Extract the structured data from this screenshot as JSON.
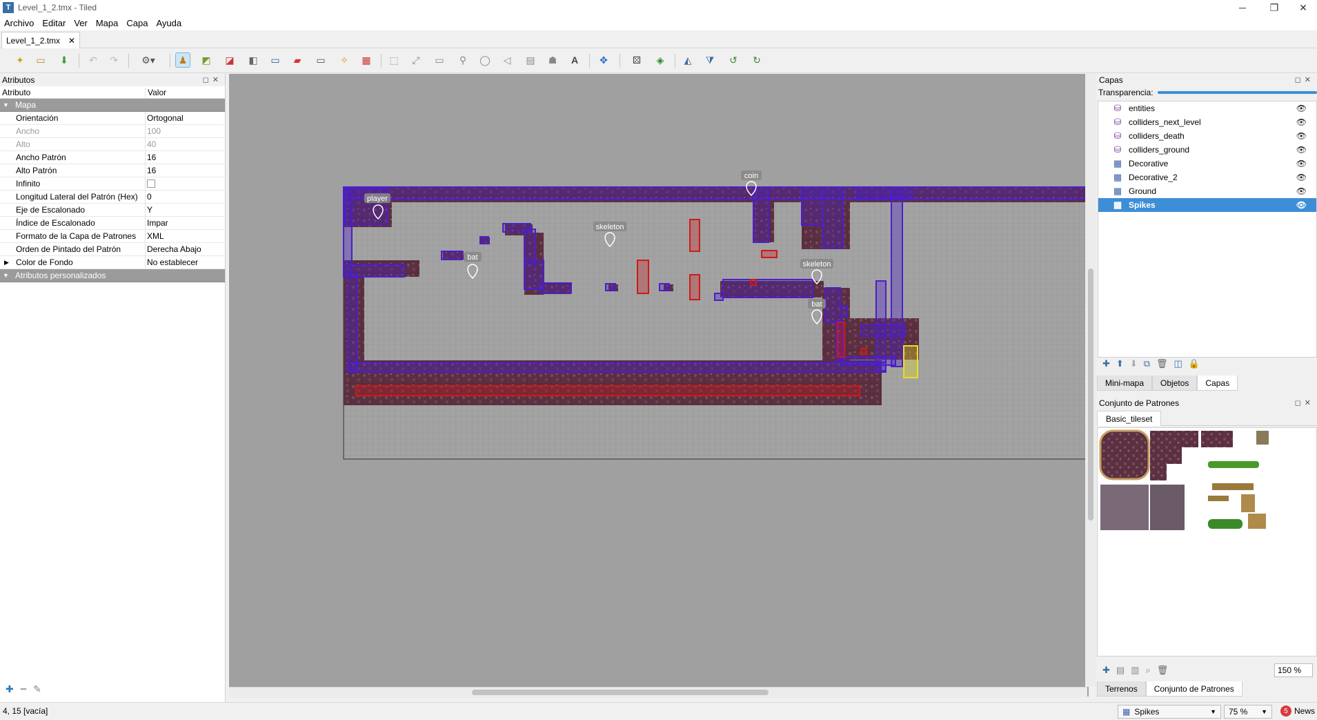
{
  "window": {
    "title": "Level_1_2.tmx - Tiled",
    "controls": [
      "─",
      "❐",
      "✕"
    ]
  },
  "menu": [
    "Archivo",
    "Editar",
    "Ver",
    "Mapa",
    "Capa",
    "Ayuda"
  ],
  "doc_tab": {
    "label": "Level_1_2.tmx",
    "close": "✕"
  },
  "properties": {
    "title": "Atributos",
    "col_attr": "Atributo",
    "col_value": "Valor",
    "group_map": "Mapa",
    "rows": [
      {
        "key": "Orientación",
        "value": "Ortogonal",
        "disabled": false
      },
      {
        "key": "Ancho",
        "value": "100",
        "disabled": true
      },
      {
        "key": "Alto",
        "value": "40",
        "disabled": true
      },
      {
        "key": "Ancho Patrón",
        "value": "16",
        "disabled": false
      },
      {
        "key": "Alto Patrón",
        "value": "16",
        "disabled": false
      },
      {
        "key": "Infinito",
        "value": "",
        "disabled": false
      },
      {
        "key": "Longitud Lateral del Patrón (Hex)",
        "value": "0",
        "disabled": false
      },
      {
        "key": "Eje de Escalonado",
        "value": "Y",
        "disabled": false
      },
      {
        "key": "Índice de Escalonado",
        "value": "Impar",
        "disabled": false
      },
      {
        "key": "Formato de la Capa de Patrones",
        "value": "XML",
        "disabled": false
      },
      {
        "key": "Orden de Pintado del Patrón",
        "value": "Derecha Abajo",
        "disabled": false
      },
      {
        "key": "Color de Fondo",
        "value": "No establecer",
        "disabled": false
      }
    ],
    "group_custom": "Atributos personalizados"
  },
  "map_labels": {
    "player": "player",
    "bat": "bat",
    "skeleton": "skeleton",
    "coin": "coin"
  },
  "layers_panel": {
    "title": "Capas",
    "opacity_label": "Transparencia:",
    "layers": [
      {
        "name": "entities",
        "kind": "object"
      },
      {
        "name": "colliders_next_level",
        "kind": "object"
      },
      {
        "name": "colliders_death",
        "kind": "object"
      },
      {
        "name": "colliders_ground",
        "kind": "object"
      },
      {
        "name": "Decorative",
        "kind": "tile"
      },
      {
        "name": "Decorative_2",
        "kind": "tile"
      },
      {
        "name": "Ground",
        "kind": "tile"
      },
      {
        "name": "Spikes",
        "kind": "tile"
      }
    ],
    "selected": "Spikes",
    "tabs": [
      "Mini-mapa",
      "Objetos",
      "Capas"
    ]
  },
  "tilesets_panel": {
    "title": "Conjunto de Patrones",
    "tileset_name": "Basic_tileset",
    "zoom": "150 %",
    "tabs": [
      "Terrenos",
      "Conjunto de Patrones"
    ]
  },
  "status": {
    "coords": "4, 15 [vacía]",
    "layer": "Spikes",
    "zoom": "75 %",
    "news": "News",
    "news_count": "5"
  },
  "colors": {
    "selection": "#3d8ed6",
    "collider": "#4b1fc8",
    "death": "#d01818",
    "next_level": "#e8e020",
    "rock": "#5a2f42"
  }
}
